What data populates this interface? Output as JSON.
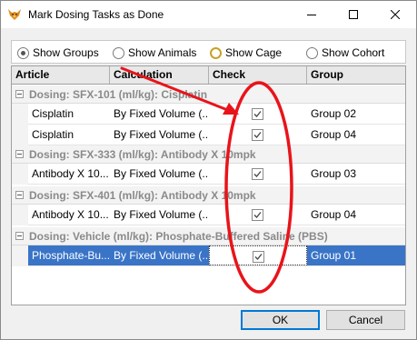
{
  "window": {
    "title": "Mark Dosing Tasks as Done"
  },
  "view_options": [
    {
      "label": "Show Groups",
      "checked": true
    },
    {
      "label": "Show Animals",
      "checked": false
    },
    {
      "label": "Show Cage",
      "checked": false
    },
    {
      "label": "Show Cohort",
      "checked": false
    }
  ],
  "grid": {
    "columns": [
      "Article",
      "Calculation",
      "Check",
      "Group"
    ],
    "groups": [
      {
        "label": "Dosing: SFX-101 (ml/kg): Cisplatin",
        "rows": [
          {
            "article": "Cisplatin",
            "calculation": "By Fixed Volume (...",
            "checked": true,
            "group": "Group 02"
          },
          {
            "article": "Cisplatin",
            "calculation": "By Fixed Volume (...",
            "checked": true,
            "group": "Group 04"
          }
        ]
      },
      {
        "label": "Dosing: SFX-333 (ml/kg): Antibody X 10mpk",
        "rows": [
          {
            "article": "Antibody X 10...",
            "calculation": "By Fixed Volume (...",
            "checked": true,
            "group": "Group 03"
          }
        ]
      },
      {
        "label": "Dosing: SFX-401 (ml/kg): Antibody X 10mpk",
        "rows": [
          {
            "article": "Antibody X 10...",
            "calculation": "By Fixed Volume (...",
            "checked": true,
            "group": "Group 04"
          }
        ]
      },
      {
        "label": "Dosing: Vehicle (ml/kg): Phosphate-Buffered Saline (PBS)",
        "rows": [
          {
            "article": "Phosphate-Bu...",
            "calculation": "By Fixed Volume (...",
            "checked": true,
            "group": "Group 01",
            "selected": true
          }
        ]
      }
    ]
  },
  "buttons": {
    "ok": "OK",
    "cancel": "Cancel"
  },
  "colors": {
    "selection": "#3a74c7",
    "annotation": "#e8141a",
    "group_text": "#8a8a8a"
  },
  "icons": {
    "app": "fox-icon",
    "minimize": "minimize-icon",
    "maximize": "maximize-icon",
    "close": "close-icon"
  }
}
